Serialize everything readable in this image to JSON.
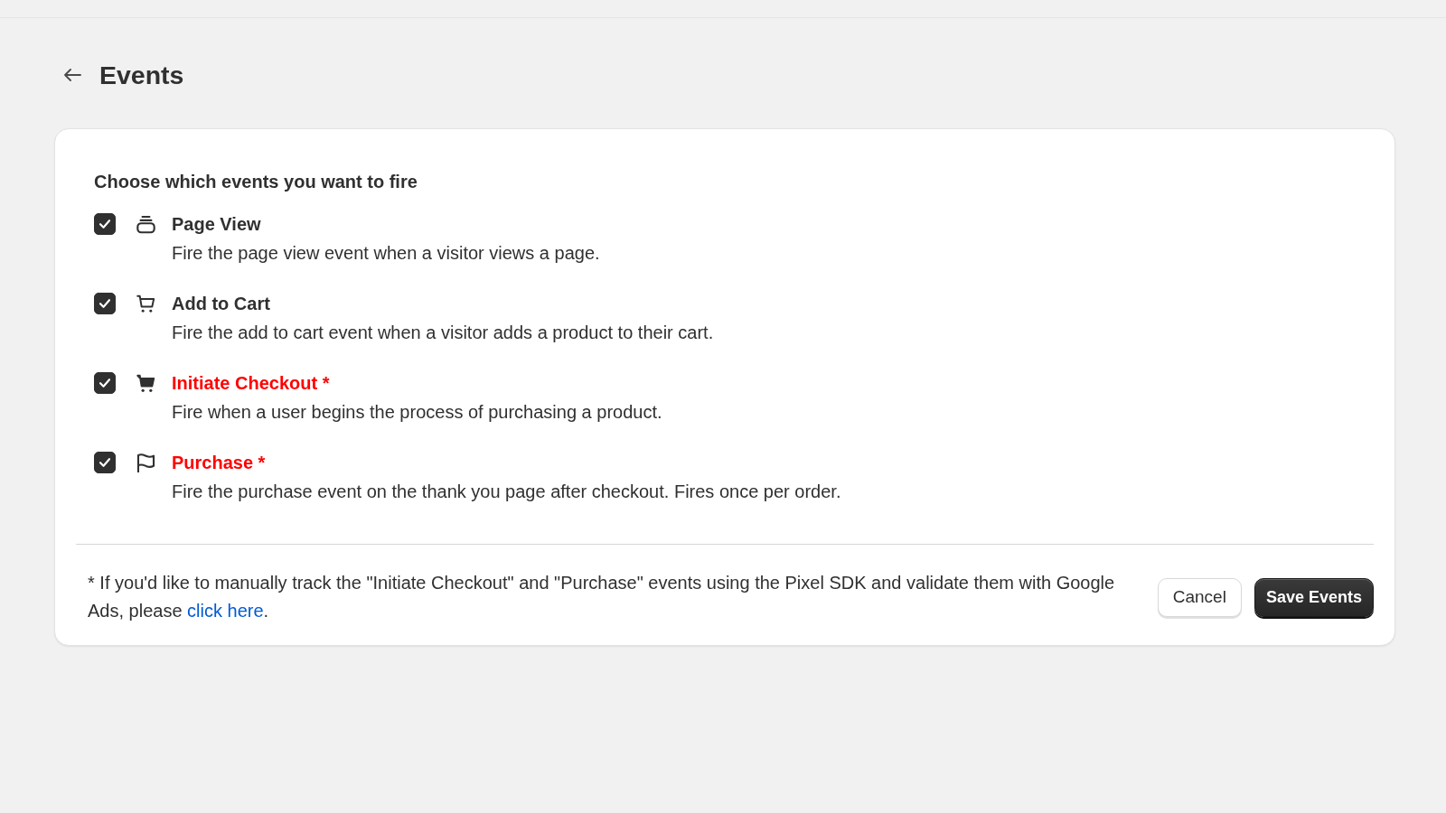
{
  "header": {
    "title": "Events"
  },
  "card": {
    "heading": "Choose which events you want to fire",
    "events": [
      {
        "kind": "pageview",
        "checked": true,
        "title": "Page View",
        "required": false,
        "description": "Fire the page view event when a visitor views a page."
      },
      {
        "kind": "cart",
        "checked": true,
        "title": "Add to Cart",
        "required": false,
        "description": "Fire the add to cart event when a visitor adds a product to their cart."
      },
      {
        "kind": "checkout",
        "checked": true,
        "title": "Initiate Checkout *",
        "required": true,
        "description": "Fire when a user begins the process of purchasing a product."
      },
      {
        "kind": "purchase",
        "checked": true,
        "title": "Purchase *",
        "required": true,
        "description": "Fire the purchase event on the thank you page after checkout. Fires once per order."
      }
    ],
    "footer": {
      "note": "* If you'd like to manually track the \"Initiate Checkout\" and \"Purchase\" events using the Pixel SDK and validate them with Google Ads, please",
      "link": "click here",
      "note_end": "."
    },
    "buttons": [
      {
        "kind": "secondary",
        "label": "Cancel"
      },
      {
        "kind": "primary",
        "label": "Save Events"
      }
    ]
  }
}
